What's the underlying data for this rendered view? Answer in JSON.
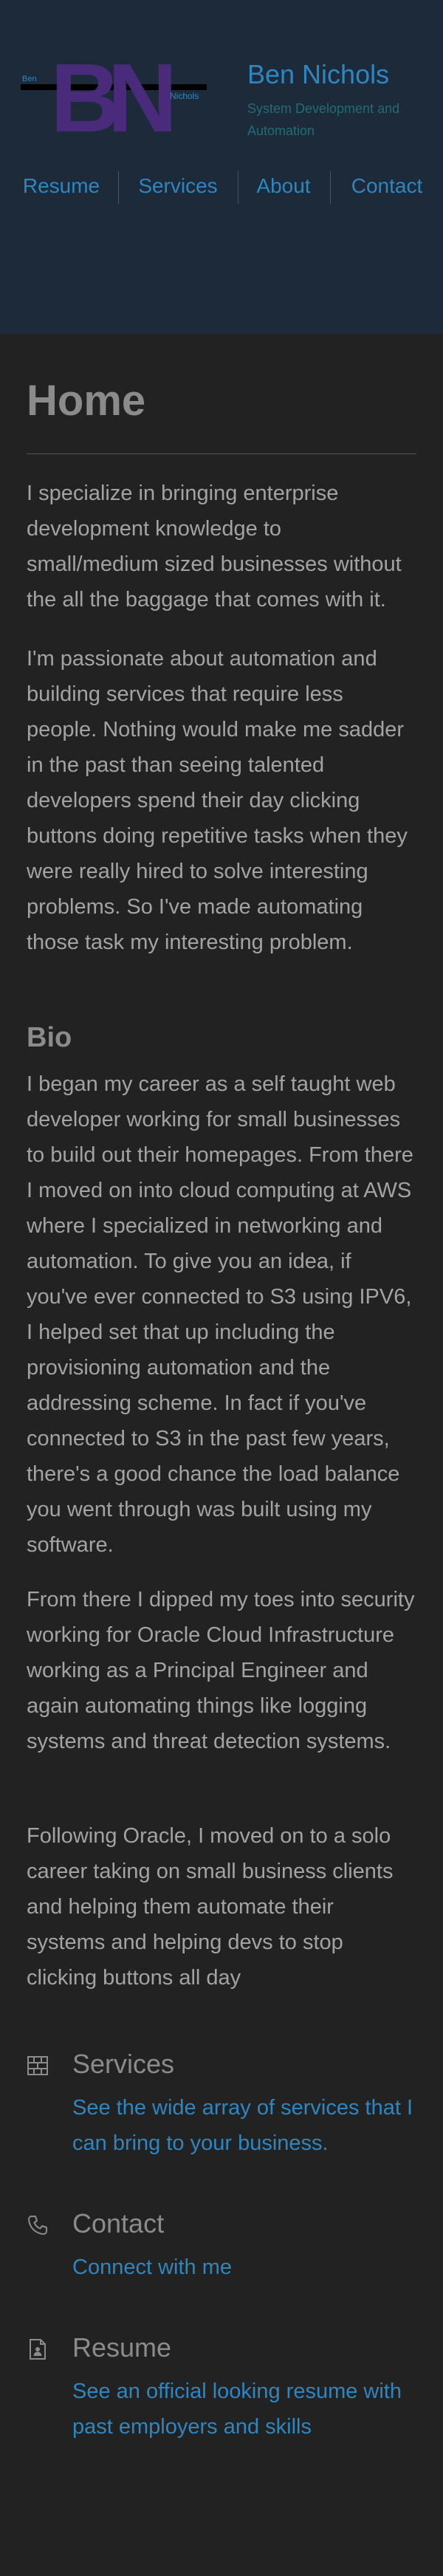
{
  "header": {
    "logo": {
      "big_letters": "BN",
      "left_text": "Ben",
      "right_text": "Nichols"
    },
    "site_title": "Ben Nichols",
    "site_subtitle": "System Development and Automation",
    "nav": [
      "Resume",
      "Services",
      "About",
      "Contact"
    ]
  },
  "main": {
    "title": "Home",
    "paragraphs": [
      "I specialize in bringing enterprise development knowledge to small/medium sized businesses without the all the baggage that comes with it.",
      "I'm passionate about automation and building services that require less people. Nothing would make me sadder in the past than seeing talented developers spend their day clicking buttons doing repetitive tasks when they were really hired to solve interesting problems. So I've made automating those task my interesting problem."
    ],
    "bio_title": "Bio",
    "bio_paragraphs": [
      "I began my career as a self taught web developer working for small businesses to build out their homepages. From there I moved on into cloud computing at AWS where I specialized in networking and automation. To give you an idea, if you've ever connected to S3 using IPV6, I helped set that up including the provisioning automation and the addressing scheme. In fact if you've connected to S3 in the past few years, there's a good chance the load balance you went through was built using my software.",
      "From there I dipped my toes into security working for Oracle Cloud Infrastructure working as a Principal Engineer and again automating things like logging systems and threat detection systems.",
      "Following Oracle, I moved on to a solo career taking on small business clients and helping them automate their systems and helping devs to stop clicking buttons all day"
    ]
  },
  "cards": [
    {
      "icon": "firewall-icon",
      "title": "Services",
      "link": "See the wide array of services that I can bring to your business."
    },
    {
      "icon": "phone-icon",
      "title": "Contact",
      "link": "Connect with me"
    },
    {
      "icon": "resume-icon",
      "title": "Resume",
      "link": "See an official looking resume with past employers and skills"
    }
  ],
  "colors": {
    "header_bg": "#1c2a3a",
    "page_bg": "#222222",
    "accent": "#2e86c1",
    "logo_purple": "#4a2a7a",
    "text": "#a3a3a3"
  }
}
